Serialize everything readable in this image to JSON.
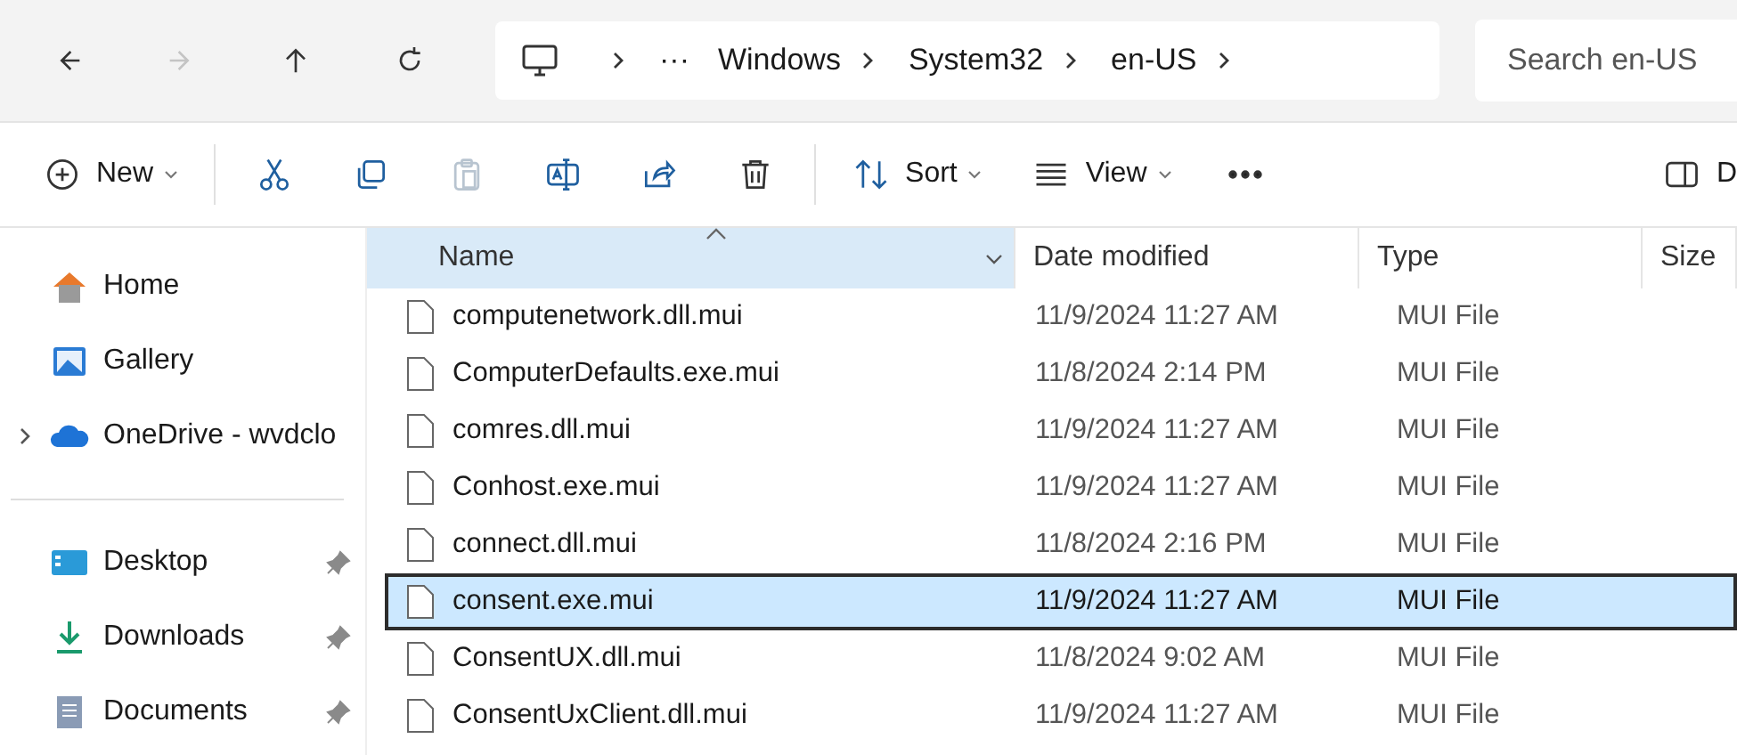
{
  "nav_buttons": [
    {
      "kind": "back",
      "disabled": false
    },
    {
      "kind": "forward",
      "disabled": true
    },
    {
      "kind": "up",
      "disabled": false
    },
    {
      "kind": "refresh",
      "disabled": false
    }
  ],
  "breadcrumb": {
    "overflow": "···",
    "items": [
      "Windows",
      "System32",
      "en-US"
    ]
  },
  "search": {
    "placeholder": "Search en-US"
  },
  "toolbar": [
    {
      "kind": "new",
      "label": "New",
      "disabled": false
    },
    {
      "kind": "cut",
      "disabled": false
    },
    {
      "kind": "copy",
      "disabled": false
    },
    {
      "kind": "paste",
      "disabled": true
    },
    {
      "kind": "rename",
      "disabled": false
    },
    {
      "kind": "share",
      "disabled": false
    },
    {
      "kind": "delete",
      "disabled": false
    },
    {
      "kind": "sort",
      "label": "Sort",
      "disabled": false
    },
    {
      "kind": "view",
      "label": "View",
      "disabled": false
    },
    {
      "kind": "more",
      "disabled": false
    },
    {
      "kind": "details",
      "label": "D",
      "disabled": false
    }
  ],
  "sidebar": {
    "items": [
      {
        "kind": "home",
        "label": "Home",
        "expandable": false,
        "pinned": false
      },
      {
        "kind": "gallery",
        "label": "Gallery",
        "expandable": false,
        "pinned": false
      },
      {
        "kind": "cloud",
        "label": "OneDrive - wvdclo",
        "expandable": true,
        "pinned": false
      },
      {
        "kind": "divider"
      },
      {
        "kind": "desktop",
        "label": "Desktop",
        "expandable": false,
        "pinned": true
      },
      {
        "kind": "downloads",
        "label": "Downloads",
        "expandable": false,
        "pinned": true
      },
      {
        "kind": "documents",
        "label": "Documents",
        "expandable": false,
        "pinned": true
      }
    ]
  },
  "table": {
    "columns": [
      {
        "label": "Name",
        "sorted": true
      },
      {
        "label": "Date modified",
        "sorted": false
      },
      {
        "label": "Type",
        "sorted": false
      },
      {
        "label": "Size",
        "sorted": false
      }
    ],
    "rows": [
      {
        "name": "computenetwork.dll.mui",
        "date": "11/9/2024 11:27 AM",
        "type": "MUI File",
        "selected": false
      },
      {
        "name": "ComputerDefaults.exe.mui",
        "date": "11/8/2024 2:14 PM",
        "type": "MUI File",
        "selected": false
      },
      {
        "name": "comres.dll.mui",
        "date": "11/9/2024 11:27 AM",
        "type": "MUI File",
        "selected": false
      },
      {
        "name": "Conhost.exe.mui",
        "date": "11/9/2024 11:27 AM",
        "type": "MUI File",
        "selected": false
      },
      {
        "name": "connect.dll.mui",
        "date": "11/8/2024 2:16 PM",
        "type": "MUI File",
        "selected": false
      },
      {
        "name": "consent.exe.mui",
        "date": "11/9/2024 11:27 AM",
        "type": "MUI File",
        "selected": true
      },
      {
        "name": "ConsentUX.dll.mui",
        "date": "11/8/2024 9:02 AM",
        "type": "MUI File",
        "selected": false
      },
      {
        "name": "ConsentUxClient.dll.mui",
        "date": "11/9/2024 11:27 AM",
        "type": "MUI File",
        "selected": false
      }
    ]
  }
}
